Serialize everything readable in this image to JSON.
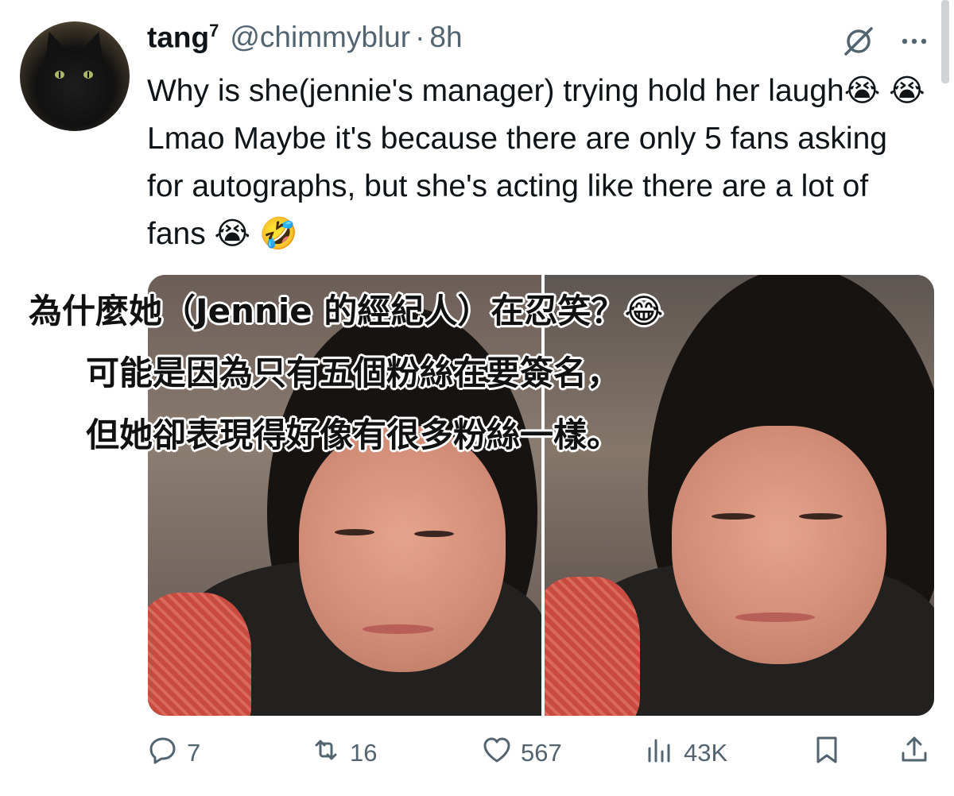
{
  "tweet": {
    "display_name": "tang",
    "name_superscript": "7",
    "handle": "@chimmyblur",
    "separator": "·",
    "time": "8h",
    "text": "Why is she(jennie's manager) trying hold her laugh😭 😭Lmao Maybe it's because there are only 5 fans asking for autographs, but she's acting like there are a lot of fans 😭 🤣"
  },
  "media": {
    "caption_lines": [
      "為什麼她（Jennie 的經紀人）在忍笑？😂",
      "可能是因為只有五個粉絲在要簽名，",
      "但她卻表現得好像有很多粉絲一樣。"
    ]
  },
  "actions": {
    "replies": "7",
    "reposts": "16",
    "likes": "567",
    "views": "43K"
  },
  "icons": {
    "header": [
      "grok-icon",
      "more-icon"
    ],
    "actions": [
      "reply-icon",
      "repost-icon",
      "like-icon",
      "views-icon",
      "bookmark-icon",
      "share-icon"
    ]
  },
  "colors": {
    "text": "#0f1419",
    "secondary": "#536471",
    "background": "#ffffff"
  }
}
